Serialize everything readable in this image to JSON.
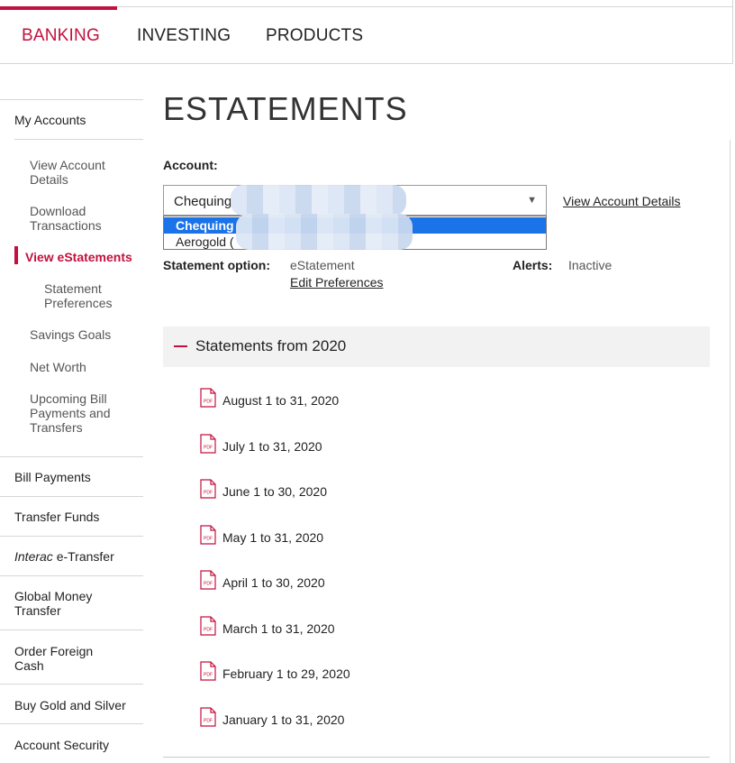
{
  "topnav": {
    "tabs": [
      {
        "label": "BANKING"
      },
      {
        "label": "INVESTING"
      },
      {
        "label": "PRODUCTS"
      }
    ]
  },
  "sidebar": {
    "my_accounts": "My Accounts",
    "view_account_details": "View Account Details",
    "download_transactions": "Download Transactions",
    "view_estatements": "View eStatements",
    "statement_preferences": "Statement Preferences",
    "savings_goals": "Savings Goals",
    "net_worth": "Net Worth",
    "upcoming_bill": "Upcoming Bill Payments and Transfers",
    "bill_payments": "Bill Payments",
    "transfer_funds": "Transfer Funds",
    "interac_italic": "Interac",
    "interac_rest": " e-Transfer",
    "global_money": "Global Money Transfer",
    "order_foreign_cash": "Order Foreign Cash",
    "buy_gold": "Buy Gold and Silver",
    "account_security": "Account Security"
  },
  "main": {
    "title": "ESTATEMENTS",
    "account_label": "Account:",
    "selected_account": "Chequing",
    "options": [
      "Chequing",
      "Aerogold ("
    ],
    "view_account_details_link": "View Account Details",
    "statement_option_label": "Statement option:",
    "statement_option_value": "eStatement",
    "edit_preferences_link": "Edit Preferences",
    "alerts_label": "Alerts:",
    "alerts_value": "Inactive",
    "section_title": "Statements from 2020",
    "statements": [
      "August 1 to 31, 2020",
      "July 1 to 31, 2020",
      "June 1 to 30, 2020",
      "May 1 to 31, 2020",
      "April 1 to 30, 2020",
      "March 1 to 31, 2020",
      "February 1 to 29, 2020",
      "January 1 to 31, 2020"
    ],
    "pdf_icon_text": "PDF"
  },
  "colors": {
    "accent": "#c3103e",
    "selection": "#1a73e8"
  }
}
